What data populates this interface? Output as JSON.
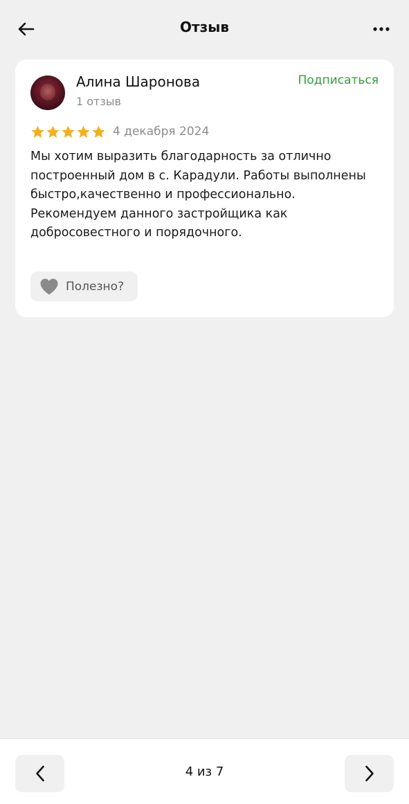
{
  "header": {
    "title": "Отзыв",
    "back_icon": "arrow-left-icon",
    "more_icon": "more-horizontal-icon"
  },
  "review": {
    "author": {
      "name": "Алина Шаронова",
      "review_count": "1 отзыв"
    },
    "subscribe_label": "Подписаться",
    "rating": 5,
    "date": "4 декабря 2024",
    "text": "Мы хотим выразить благодарность за отлично построенный дом в с. Карадули. Работы выполнены быстро,качественно и профессионально. Рекомендуем данного застройщика как добросовестного и порядочного.",
    "useful_label": "Полезно?",
    "useful_icon": "heart-icon"
  },
  "pagination": {
    "label": "4 из 7",
    "prev_icon": "chevron-left-icon",
    "next_icon": "chevron-right-icon"
  },
  "colors": {
    "background": "#f0f0f0",
    "card": "#ffffff",
    "accent_green": "#2e9e3a",
    "star": "#f2b01e",
    "muted_text": "#8c8c8c"
  }
}
